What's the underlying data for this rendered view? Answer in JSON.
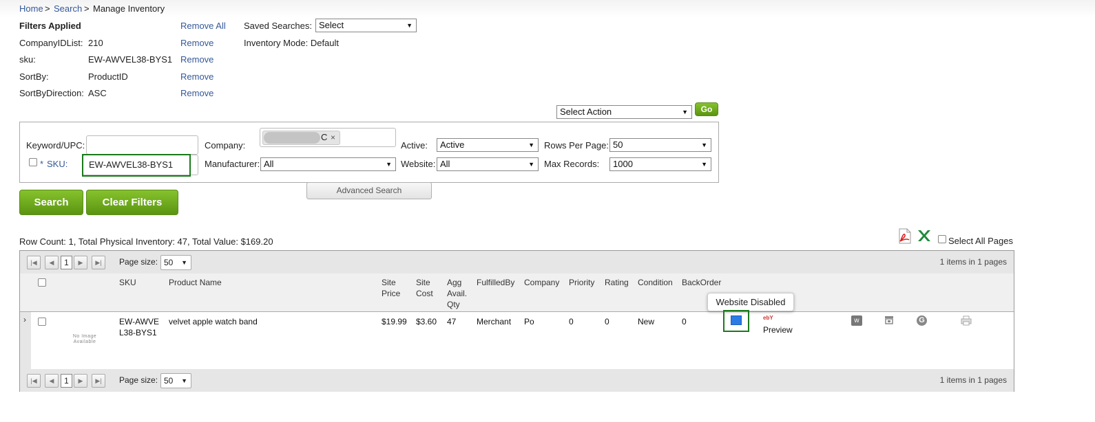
{
  "breadcrumb": {
    "home": "Home",
    "sep1": ">",
    "search": "Search",
    "sep2": ">",
    "current": "Manage Inventory"
  },
  "filters_applied": {
    "title": "Filters Applied",
    "remove_all": "Remove All",
    "items": [
      {
        "label": "CompanyIDList:",
        "value": "210",
        "remove": "Remove"
      },
      {
        "label": "sku:",
        "value": "EW-AWVEL38-BYS1",
        "remove": "Remove"
      },
      {
        "label": "SortBy:",
        "value": "ProductID",
        "remove": "Remove"
      },
      {
        "label": "SortByDirection:",
        "value": "ASC",
        "remove": "Remove"
      }
    ]
  },
  "saved_searches": {
    "label": "Saved Searches:",
    "value": "Select"
  },
  "inventory_mode": "Inventory Mode: Default",
  "action": {
    "select": "Select Action",
    "go": "Go"
  },
  "search_form": {
    "keyword_label": "Keyword/UPC:",
    "keyword_value": "",
    "sku_prefix": "*",
    "sku_label": "SKU:",
    "sku_value": "EW-AWVEL38-BYS1",
    "company_label": "Company:",
    "company_chip_tail": "C",
    "company_chip_remove": "×",
    "manufacturer_label": "Manufacturer:",
    "manufacturer_value": "All",
    "active_label": "Active:",
    "active_value": "Active",
    "website_label": "Website:",
    "website_value": "All",
    "rows_label": "Rows Per Page:",
    "rows_value": "50",
    "max_label": "Max Records:",
    "max_value": "1000",
    "advanced": "Advanced Search",
    "search_btn": "Search",
    "clear_btn": "Clear Filters"
  },
  "summary": "Row Count: 1, Total Physical Inventory: 47, Total Value: $169.20",
  "select_all_pages": "Select All Pages",
  "pager": {
    "page": "1",
    "page_size_label": "Page size:",
    "page_size": "50",
    "items_info": "1 items in 1 pages"
  },
  "columns": {
    "sku": "SKU",
    "product_name": "Product Name",
    "site_price": "Site Price",
    "site_cost": "Site Cost",
    "agg_qty": "Agg Avail. Qty",
    "fulfilled_by": "FulfilledBy",
    "company": "Company",
    "priority": "Priority",
    "rating": "Rating",
    "condition": "Condition",
    "backorder": "BackOrder"
  },
  "row": {
    "no_image": "No Image Available",
    "sku": "EW-AWVEL38-BYS1",
    "product_name": "velvet apple watch band",
    "site_price": "$19.99",
    "site_cost": "$3.60",
    "agg_qty": "47",
    "fulfilled_by": "Merchant",
    "company": "Po",
    "priority": "0",
    "rating": "0",
    "condition": "New",
    "backorder": "0",
    "ebay_mark": "ebY",
    "preview": "Preview"
  },
  "tooltip": "Website Disabled",
  "colors": {
    "link": "#34589a",
    "green_button": "#6aa71b",
    "highlight_frame": "#1a7a1a",
    "website_icon": "#2a7be4"
  },
  "icons": [
    "pdf-export-icon",
    "excel-export-icon",
    "wayfair-icon",
    "ship-icon",
    "refresh-icon",
    "print-icon"
  ]
}
